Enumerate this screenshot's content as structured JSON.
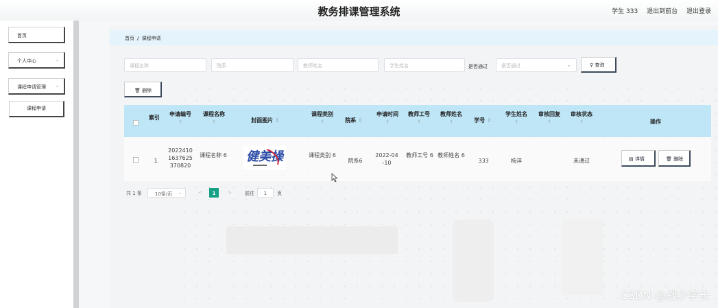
{
  "header": {
    "title": "教务排课管理系统",
    "user": "学生 333",
    "back_link": "退出到前台",
    "logout_link": "退出登录"
  },
  "sidebar": {
    "items": [
      {
        "label": "首页"
      },
      {
        "label": "个人中心"
      },
      {
        "label": "课程申请管理"
      },
      {
        "label": "课程申请"
      }
    ]
  },
  "breadcrumb": {
    "home": "首页",
    "separator": "/",
    "current": "课程申请"
  },
  "search": {
    "course_name_placeholder": "课程名称",
    "dept_placeholder": "院系",
    "teacher_name_placeholder": "教师姓名",
    "student_name_placeholder": "学生姓名",
    "passed_label": "是否通过",
    "passed_placeholder": "是否通过",
    "search_button": "查询",
    "search_icon": "search-icon"
  },
  "toolbar": {
    "delete_button": "删除",
    "delete_icon": "trash-icon"
  },
  "table": {
    "headers": {
      "index": "索引",
      "apply_no": "申请编号",
      "course_name": "课程名称",
      "cover": "封面图片",
      "course_type": "课程类别",
      "dept": "院系",
      "apply_time": "申请时间",
      "teacher_no": "教师工号",
      "teacher_name": "教师姓名",
      "student_no": "学号",
      "student_name": "学生姓名",
      "review_reply": "审核回复",
      "review_status": "审核状态",
      "actions": "操作"
    },
    "rows": [
      {
        "index": "1",
        "apply_no": "2022410 1637625 370820",
        "course_name": "课程名称 6",
        "cover_text": "健美操",
        "course_type": "课程类别 6",
        "dept": "院系6",
        "apply_time": "2022-04 -10",
        "teacher_no": "教师工号 6",
        "teacher_name": "教师姓名 6",
        "student_no": "333",
        "student_name": "杨洋",
        "review_reply": "",
        "review_status": "未通过",
        "detail_button": "详情",
        "delete_button": "删除"
      }
    ]
  },
  "pagination": {
    "total": "共 1 条",
    "page_size": "10条/页",
    "prev": "<",
    "current_page": "1",
    "next": ">",
    "goto_label": "前往",
    "goto_value": "1",
    "page_suffix": "页"
  },
  "watermark": "CSDN @战少学长",
  "colors": {
    "accent": "#16a085",
    "header_blue": "#bfe6f7",
    "breadcrumb_bg": "#e5f4fc"
  }
}
